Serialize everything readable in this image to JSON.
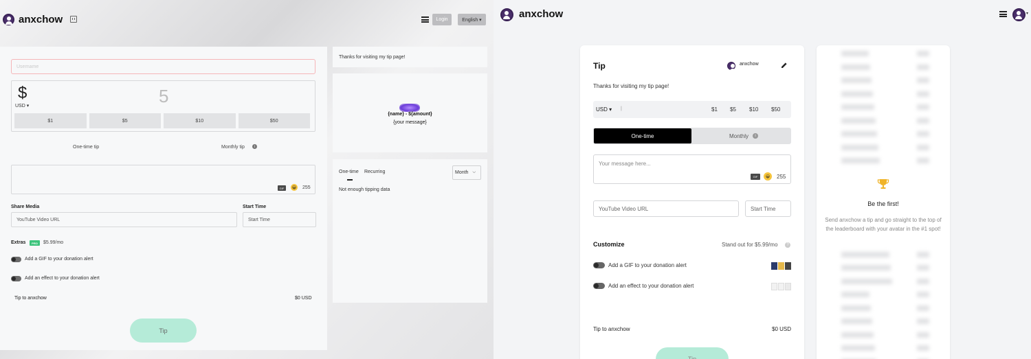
{
  "left": {
    "brand": "anxchow",
    "login_label": "Login",
    "language_label": "English ▾",
    "username_placeholder": "Username",
    "currency_symbol": "$",
    "amount_placeholder": "5",
    "currency": "USD ▾",
    "presets": [
      "$1",
      "$5",
      "$10",
      "$50"
    ],
    "one_time_label": "One-time tip",
    "monthly_label": "Monthly tip",
    "gif_badge": "GIF",
    "emoji": "😀",
    "char_count": "255",
    "share_media_label": "Share Media",
    "start_time_label": "Start Time",
    "youtube_placeholder": "YouTube Video URL",
    "start_time_placeholder": "Start Time",
    "extras_label": "Extras",
    "pro_badge": "PRO",
    "pro_price": "$5.99/mo",
    "gif_option": "Add a GIF to your donation alert",
    "effect_option": "Add an effect to your donation alert",
    "tip_to": "Tip to anxchow",
    "total": "$0 USD",
    "tip_button": "Tip",
    "thanks_message": "Thanks for visiting my tip page!",
    "preview_line1": "{name} - ${amount}",
    "preview_line2": "{your message}",
    "stats_tab_one_time": "One-time",
    "stats_tab_recurring": "Recurring",
    "period_select": "Month",
    "stats_empty": "Not enough tipping data"
  },
  "right": {
    "brand": "anxchow",
    "card_title": "Tip",
    "creator_name": "anxchow",
    "thanks_message": "Thanks for visiting my tip page!",
    "currency": "USD ▾",
    "presets": [
      "$1",
      "$5",
      "$10",
      "$50"
    ],
    "seg_one_time": "One-time",
    "seg_monthly": "Monthly",
    "message_placeholder": "Your message here...",
    "gif_badge": "GIF",
    "emoji": "😀",
    "char_count": "255",
    "youtube_placeholder": "YouTube Video URL",
    "start_time_placeholder": "Start Time",
    "customize_label": "Customize",
    "stand_out": "Stand out for $5.99/mo",
    "gif_option": "Add a GIF to your donation alert",
    "effect_option": "Add an effect to your donation alert",
    "tip_to": "Tip to anxchow",
    "total": "$0 USD",
    "tip_button": "Tip",
    "leader_title": "Be the first!",
    "leader_text": "Send anxchow a tip and go straight to the top of the leaderboard with your avatar in the #1 spot!"
  },
  "colors": {
    "accent_mint": "#b5ebd8",
    "brand_purple": "#4a2f6b",
    "pro_green": "#3cc47c",
    "error_border": "#f5b5b8"
  }
}
